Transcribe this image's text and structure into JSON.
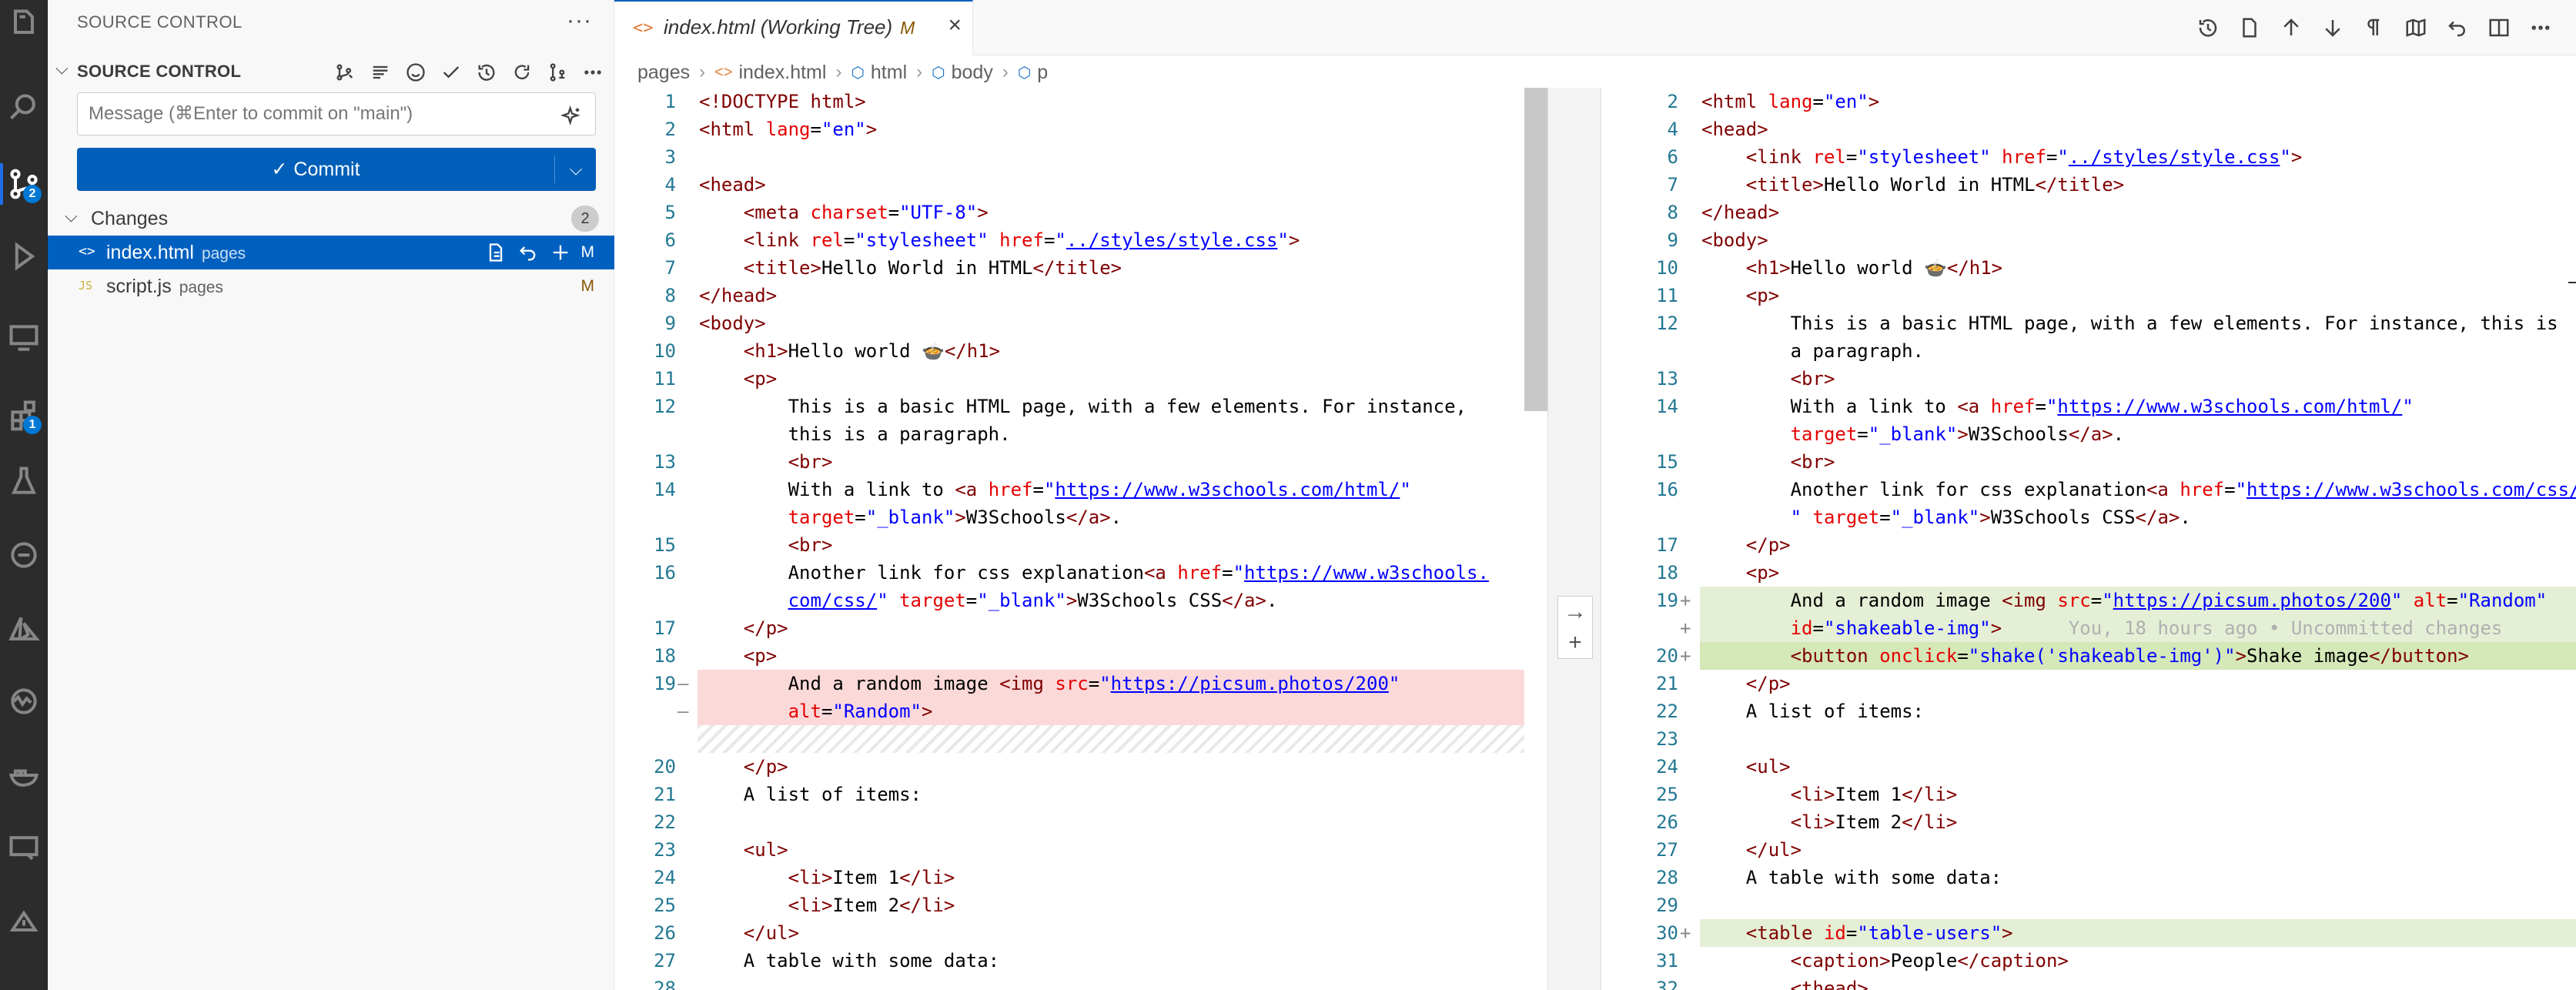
{
  "activity_bar": {
    "source_control_badge": "2",
    "extensions_badge": "1"
  },
  "sidebar": {
    "title": "SOURCE CONTROL",
    "section_title": "SOURCE CONTROL",
    "message_placeholder": "Message (⌘Enter to commit on \"main\")",
    "commit_label": "Commit",
    "changes_label": "Changes",
    "changes_count": "2",
    "files": [
      {
        "icon": "<>",
        "name": "index.html",
        "dir": "pages",
        "status": "M"
      },
      {
        "icon": "JS",
        "name": "script.js",
        "dir": "pages",
        "status": "M"
      }
    ]
  },
  "tab": {
    "title": "index.html (Working Tree)",
    "status": "M"
  },
  "breadcrumb": [
    "pages",
    "index.html",
    "html",
    "body",
    "p"
  ],
  "left_lines": [
    {
      "n": "1",
      "c": [
        [
          "t",
          "<!DOCTYPE html>"
        ]
      ]
    },
    {
      "n": "2",
      "c": [
        [
          "t",
          "<html "
        ],
        [
          "a",
          "lang"
        ],
        [
          "x",
          "="
        ],
        [
          "v",
          "\"en\""
        ],
        [
          "t",
          ">"
        ]
      ]
    },
    {
      "n": "3",
      "c": []
    },
    {
      "n": "4",
      "c": [
        [
          "t",
          "<head>"
        ]
      ]
    },
    {
      "n": "5",
      "c": [
        [
          "x",
          "    "
        ],
        [
          "t",
          "<meta "
        ],
        [
          "a",
          "charset"
        ],
        [
          "x",
          "="
        ],
        [
          "v",
          "\"UTF-8\""
        ],
        [
          "t",
          ">"
        ]
      ]
    },
    {
      "n": "6",
      "c": [
        [
          "x",
          "    "
        ],
        [
          "t",
          "<link "
        ],
        [
          "a",
          "rel"
        ],
        [
          "x",
          "="
        ],
        [
          "v",
          "\"stylesheet\""
        ],
        [
          "x",
          " "
        ],
        [
          "a",
          "href"
        ],
        [
          "x",
          "="
        ],
        [
          "v",
          "\""
        ],
        [
          "u",
          "../styles/style.css"
        ],
        [
          "v",
          "\""
        ],
        [
          "t",
          ">"
        ]
      ]
    },
    {
      "n": "7",
      "c": [
        [
          "x",
          "    "
        ],
        [
          "t",
          "<title>"
        ],
        [
          "x",
          "Hello World in HTML"
        ],
        [
          "t",
          "</title>"
        ]
      ]
    },
    {
      "n": "8",
      "c": [
        [
          "t",
          "</head>"
        ]
      ]
    },
    {
      "n": "9",
      "c": [
        [
          "t",
          "<body>"
        ]
      ]
    },
    {
      "n": "10",
      "c": [
        [
          "x",
          "    "
        ],
        [
          "t",
          "<h1>"
        ],
        [
          "x",
          "Hello world 🍲"
        ],
        [
          "t",
          "</h1>"
        ]
      ]
    },
    {
      "n": "11",
      "c": [
        [
          "x",
          "    "
        ],
        [
          "t",
          "<p>"
        ]
      ]
    },
    {
      "n": "12",
      "c": [
        [
          "x",
          "        This is a basic HTML page, with a few elements. For instance,"
        ]
      ]
    },
    {
      "n": "",
      "c": [
        [
          "x",
          "        this is a paragraph."
        ]
      ]
    },
    {
      "n": "13",
      "c": [
        [
          "x",
          "        "
        ],
        [
          "t",
          "<br>"
        ]
      ]
    },
    {
      "n": "14",
      "c": [
        [
          "x",
          "        With a link to "
        ],
        [
          "t",
          "<a "
        ],
        [
          "a",
          "href"
        ],
        [
          "x",
          "="
        ],
        [
          "v",
          "\""
        ],
        [
          "u",
          "https://www.w3schools.com/html/"
        ],
        [
          "v",
          "\""
        ]
      ]
    },
    {
      "n": "",
      "c": [
        [
          "x",
          "        "
        ],
        [
          "a",
          "target"
        ],
        [
          "x",
          "="
        ],
        [
          "v",
          "\"_blank\""
        ],
        [
          "t",
          ">"
        ],
        [
          "x",
          "W3Schools"
        ],
        [
          "t",
          "</a>"
        ],
        [
          "x",
          "."
        ]
      ]
    },
    {
      "n": "15",
      "c": [
        [
          "x",
          "        "
        ],
        [
          "t",
          "<br>"
        ]
      ]
    },
    {
      "n": "16",
      "c": [
        [
          "x",
          "        Another link for css explanation"
        ],
        [
          "t",
          "<a "
        ],
        [
          "a",
          "href"
        ],
        [
          "x",
          "="
        ],
        [
          "v",
          "\""
        ],
        [
          "u",
          "https://www.w3schools."
        ]
      ]
    },
    {
      "n": "",
      "c": [
        [
          "x",
          "        "
        ],
        [
          "u",
          "com/css/"
        ],
        [
          "v",
          "\""
        ],
        [
          "x",
          " "
        ],
        [
          "a",
          "target"
        ],
        [
          "x",
          "="
        ],
        [
          "v",
          "\"_blank\""
        ],
        [
          "t",
          ">"
        ],
        [
          "x",
          "W3Schools CSS"
        ],
        [
          "t",
          "</a>"
        ],
        [
          "x",
          "."
        ]
      ]
    },
    {
      "n": "17",
      "c": [
        [
          "x",
          "    "
        ],
        [
          "t",
          "</p>"
        ]
      ]
    },
    {
      "n": "18",
      "c": [
        [
          "x",
          "    "
        ],
        [
          "t",
          "<p>"
        ]
      ]
    },
    {
      "n": "19",
      "m": "—",
      "k": "del",
      "c": [
        [
          "x",
          "        And a random image "
        ],
        [
          "t",
          "<img "
        ],
        [
          "a",
          "src"
        ],
        [
          "x",
          "="
        ],
        [
          "v",
          "\""
        ],
        [
          "u",
          "https://picsum.photos/200"
        ],
        [
          "v",
          "\""
        ]
      ]
    },
    {
      "n": "",
      "m": "—",
      "k": "del",
      "c": [
        [
          "x",
          "        "
        ],
        [
          "a",
          "alt"
        ],
        [
          "x",
          "="
        ],
        [
          "v",
          "\"Random\""
        ],
        [
          "t",
          ">"
        ]
      ]
    },
    {
      "n": "",
      "k": "hatch",
      "c": []
    },
    {
      "n": "20",
      "c": [
        [
          "x",
          "    "
        ],
        [
          "t",
          "</p>"
        ]
      ]
    },
    {
      "n": "21",
      "c": [
        [
          "x",
          "    A list of items:"
        ]
      ]
    },
    {
      "n": "22",
      "c": []
    },
    {
      "n": "23",
      "c": [
        [
          "x",
          "    "
        ],
        [
          "t",
          "<ul>"
        ]
      ]
    },
    {
      "n": "24",
      "c": [
        [
          "x",
          "        "
        ],
        [
          "t",
          "<li>"
        ],
        [
          "x",
          "Item 1"
        ],
        [
          "t",
          "</li>"
        ]
      ]
    },
    {
      "n": "25",
      "c": [
        [
          "x",
          "        "
        ],
        [
          "t",
          "<li>"
        ],
        [
          "x",
          "Item 2"
        ],
        [
          "t",
          "</li>"
        ]
      ]
    },
    {
      "n": "26",
      "c": [
        [
          "x",
          "    "
        ],
        [
          "t",
          "</ul>"
        ]
      ]
    },
    {
      "n": "27",
      "c": [
        [
          "x",
          "    A table with some data:"
        ]
      ]
    },
    {
      "n": "28",
      "c": []
    }
  ],
  "right_lines": [
    {
      "n": "2",
      "c": [
        [
          "t",
          "<html "
        ],
        [
          "a",
          "lang"
        ],
        [
          "x",
          "="
        ],
        [
          "v",
          "\"en\""
        ],
        [
          "t",
          ">"
        ]
      ]
    },
    {
      "n": "4",
      "c": [
        [
          "t",
          "<head>"
        ]
      ]
    },
    {
      "n": "6",
      "c": [
        [
          "x",
          "    "
        ],
        [
          "t",
          "<link "
        ],
        [
          "a",
          "rel"
        ],
        [
          "x",
          "="
        ],
        [
          "v",
          "\"stylesheet\""
        ],
        [
          "x",
          " "
        ],
        [
          "a",
          "href"
        ],
        [
          "x",
          "="
        ],
        [
          "v",
          "\""
        ],
        [
          "u",
          "../styles/style.css"
        ],
        [
          "v",
          "\""
        ],
        [
          "t",
          ">"
        ]
      ]
    },
    {
      "n": "7",
      "c": [
        [
          "x",
          "    "
        ],
        [
          "t",
          "<title>"
        ],
        [
          "x",
          "Hello World in HTML"
        ],
        [
          "t",
          "</title>"
        ]
      ]
    },
    {
      "n": "8",
      "c": [
        [
          "t",
          "</head>"
        ]
      ]
    },
    {
      "n": "9",
      "c": [
        [
          "t",
          "<body>"
        ]
      ]
    },
    {
      "n": "10",
      "c": [
        [
          "x",
          "    "
        ],
        [
          "t",
          "<h1>"
        ],
        [
          "x",
          "Hello world 🍲"
        ],
        [
          "t",
          "</h1>"
        ]
      ]
    },
    {
      "n": "11",
      "c": [
        [
          "x",
          "    "
        ],
        [
          "t",
          "<p>"
        ]
      ]
    },
    {
      "n": "12",
      "c": [
        [
          "x",
          "        This is a basic HTML page, with a few elements. For instance, this is"
        ]
      ]
    },
    {
      "n": "",
      "c": [
        [
          "x",
          "        a paragraph."
        ]
      ]
    },
    {
      "n": "13",
      "c": [
        [
          "x",
          "        "
        ],
        [
          "t",
          "<br>"
        ]
      ]
    },
    {
      "n": "14",
      "c": [
        [
          "x",
          "        With a link to "
        ],
        [
          "t",
          "<a "
        ],
        [
          "a",
          "href"
        ],
        [
          "x",
          "="
        ],
        [
          "v",
          "\""
        ],
        [
          "u",
          "https://www.w3schools.com/html/"
        ],
        [
          "v",
          "\""
        ]
      ]
    },
    {
      "n": "",
      "c": [
        [
          "x",
          "        "
        ],
        [
          "a",
          "target"
        ],
        [
          "x",
          "="
        ],
        [
          "v",
          "\"_blank\""
        ],
        [
          "t",
          ">"
        ],
        [
          "x",
          "W3Schools"
        ],
        [
          "t",
          "</a>"
        ],
        [
          "x",
          "."
        ]
      ]
    },
    {
      "n": "15",
      "c": [
        [
          "x",
          "        "
        ],
        [
          "t",
          "<br>"
        ]
      ]
    },
    {
      "n": "16",
      "c": [
        [
          "x",
          "        Another link for css explanation"
        ],
        [
          "t",
          "<a "
        ],
        [
          "a",
          "href"
        ],
        [
          "x",
          "="
        ],
        [
          "v",
          "\""
        ],
        [
          "u",
          "https://www.w3schools.com/css/"
        ]
      ]
    },
    {
      "n": "",
      "c": [
        [
          "x",
          "        "
        ],
        [
          "v",
          "\""
        ],
        [
          "x",
          " "
        ],
        [
          "a",
          "target"
        ],
        [
          "x",
          "="
        ],
        [
          "v",
          "\"_blank\""
        ],
        [
          "t",
          ">"
        ],
        [
          "x",
          "W3Schools CSS"
        ],
        [
          "t",
          "</a>"
        ],
        [
          "x",
          "."
        ]
      ]
    },
    {
      "n": "17",
      "c": [
        [
          "x",
          "    "
        ],
        [
          "t",
          "</p>"
        ]
      ]
    },
    {
      "n": "18",
      "c": [
        [
          "x",
          "    "
        ],
        [
          "t",
          "<p>"
        ]
      ]
    },
    {
      "n": "19",
      "m": "+",
      "k": "add",
      "c": [
        [
          "x",
          "        And a random image "
        ],
        [
          "t",
          "<img "
        ],
        [
          "a",
          "src"
        ],
        [
          "x",
          "="
        ],
        [
          "v",
          "\""
        ],
        [
          "u",
          "https://picsum.photos/200"
        ],
        [
          "v",
          "\""
        ],
        [
          "x",
          " "
        ],
        [
          "a",
          "alt"
        ],
        [
          "x",
          "="
        ],
        [
          "v",
          "\"Random\""
        ]
      ]
    },
    {
      "n": "",
      "m": "+",
      "k": "add",
      "c": [
        [
          "x",
          "        "
        ],
        [
          "a",
          "id"
        ],
        [
          "x",
          "="
        ],
        [
          "v",
          "\"shakeable-img\""
        ],
        [
          "t",
          ">"
        ],
        [
          "g",
          "      You, 18 hours ago • Uncommitted changes"
        ]
      ]
    },
    {
      "n": "20",
      "m": "+",
      "k": "addline",
      "c": [
        [
          "x",
          "        "
        ],
        [
          "t",
          "<button "
        ],
        [
          "a",
          "onclick"
        ],
        [
          "x",
          "="
        ],
        [
          "v",
          "\"shake('shakeable-img')\""
        ],
        [
          "t",
          ">"
        ],
        [
          "x",
          "Shake image"
        ],
        [
          "t",
          "</button>"
        ]
      ]
    },
    {
      "n": "21",
      "c": [
        [
          "x",
          "    "
        ],
        [
          "t",
          "</p>"
        ]
      ]
    },
    {
      "n": "22",
      "c": [
        [
          "x",
          "    A list of items:"
        ]
      ]
    },
    {
      "n": "23",
      "c": []
    },
    {
      "n": "24",
      "c": [
        [
          "x",
          "    "
        ],
        [
          "t",
          "<ul>"
        ]
      ]
    },
    {
      "n": "25",
      "c": [
        [
          "x",
          "        "
        ],
        [
          "t",
          "<li>"
        ],
        [
          "x",
          "Item 1"
        ],
        [
          "t",
          "</li>"
        ]
      ]
    },
    {
      "n": "26",
      "c": [
        [
          "x",
          "        "
        ],
        [
          "t",
          "<li>"
        ],
        [
          "x",
          "Item 2"
        ],
        [
          "t",
          "</li>"
        ]
      ]
    },
    {
      "n": "27",
      "c": [
        [
          "x",
          "    "
        ],
        [
          "t",
          "</ul>"
        ]
      ]
    },
    {
      "n": "28",
      "c": [
        [
          "x",
          "    A table with some data:"
        ]
      ]
    },
    {
      "n": "29",
      "c": []
    },
    {
      "n": "30",
      "m": "+",
      "k": "add",
      "c": [
        [
          "x",
          "    "
        ],
        [
          "t",
          "<table "
        ],
        [
          "a",
          "id"
        ],
        [
          "x",
          "="
        ],
        [
          "v",
          "\"table-users\""
        ],
        [
          "t",
          ">"
        ]
      ]
    },
    {
      "n": "31",
      "c": [
        [
          "x",
          "        "
        ],
        [
          "t",
          "<caption>"
        ],
        [
          "x",
          "People"
        ],
        [
          "t",
          "</caption>"
        ]
      ]
    },
    {
      "n": "32",
      "c": [
        [
          "x",
          "        "
        ],
        [
          "t",
          "<thead>"
        ]
      ]
    }
  ]
}
